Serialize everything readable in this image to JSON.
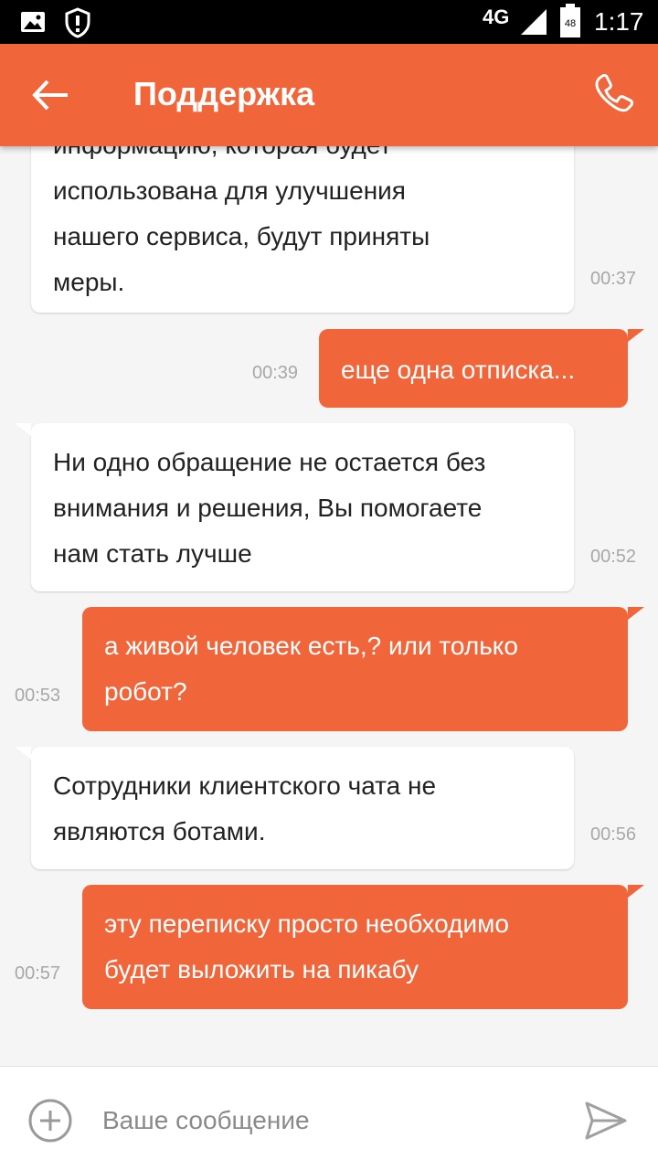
{
  "status_bar": {
    "network": "4G",
    "battery_level": "48",
    "time": "1:17",
    "icons": [
      "image-notification-icon",
      "shield-alert-icon",
      "signal-icon",
      "battery-icon"
    ]
  },
  "header": {
    "title": "Поддержка",
    "back_icon": "arrow-left-icon",
    "call_icon": "phone-icon"
  },
  "messages": [
    {
      "direction": "incoming",
      "lines": [
        "информацию, которая будет",
        "использована для улучшения",
        "нашего сервиса, будут приняты",
        "меры."
      ],
      "time": "00:37"
    },
    {
      "direction": "outgoing",
      "lines": [
        "еще одна отписка..."
      ],
      "time": "00:39"
    },
    {
      "direction": "incoming",
      "lines": [
        "Ни одно обращение не остается без",
        "внимания и решения, Вы помогаете",
        "нам стать лучше"
      ],
      "time": "00:52"
    },
    {
      "direction": "outgoing",
      "lines": [
        "а живой человек есть,? или только",
        "робот?"
      ],
      "time": "00:53"
    },
    {
      "direction": "incoming",
      "lines": [
        "Сотрудники клиентского чата не",
        "являются ботами."
      ],
      "time": "00:56"
    },
    {
      "direction": "outgoing",
      "lines": [
        "эту переписку просто необходимо",
        "будет выложить на пикабу"
      ],
      "time": "00:57"
    }
  ],
  "composer": {
    "placeholder": "Ваше сообщение",
    "value": "",
    "attach_icon": "plus-circle-icon",
    "send_icon": "send-icon"
  },
  "colors": {
    "accent": "#f0653a",
    "background": "#f5f5f5",
    "incoming_bubble": "#ffffff",
    "timestamp": "#a8a8a8"
  }
}
